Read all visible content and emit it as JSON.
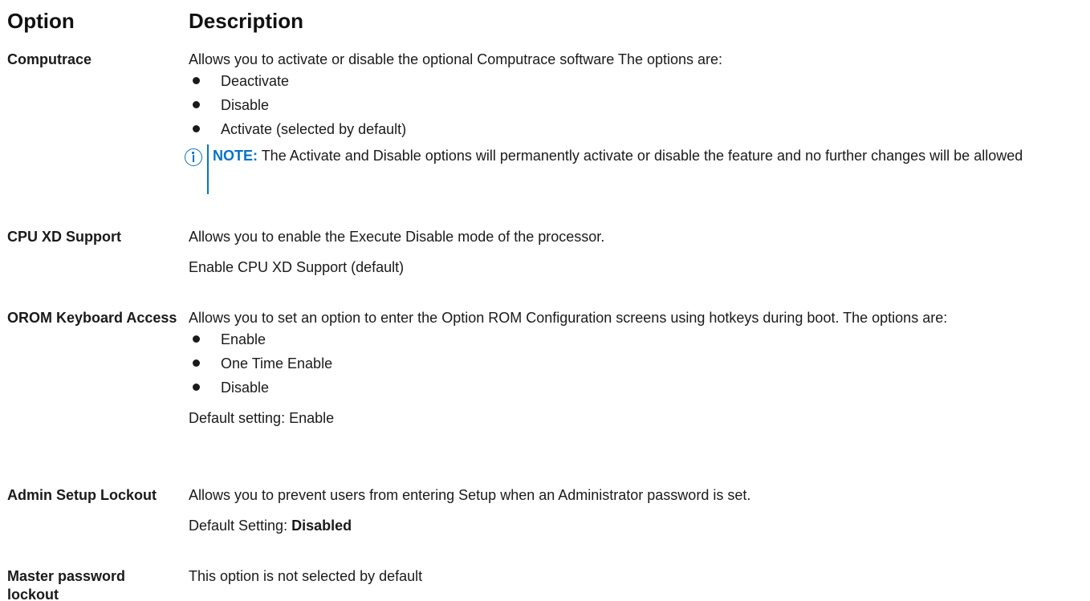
{
  "header": {
    "option": "Option",
    "description": "Description"
  },
  "rows": [
    {
      "option": "Computrace",
      "intro": "Allows you to activate or disable the optional Computrace software The options are:",
      "options": [
        "Deactivate",
        "Disable",
        "Activate (selected by default)"
      ],
      "note": {
        "label": "NOTE:",
        "text": "The Activate and Disable options will permanently activate or disable the feature and no further changes will be allowed"
      }
    },
    {
      "option": "CPU XD Support",
      "intro": "Allows you to enable the Execute Disable mode of the processor.",
      "detail": "Enable CPU XD Support (default)"
    },
    {
      "option": "OROM Keyboard Access",
      "intro": "Allows you to set an option to enter the Option ROM Configuration screens using hotkeys during boot. The options are:",
      "options": [
        "Enable",
        "One Time Enable",
        "Disable"
      ],
      "detail": "Default setting: Enable"
    },
    {
      "option": "Admin Setup Lockout",
      "intro": "Allows you to prevent users from entering Setup when an Administrator password is set.",
      "default_label": "Default Setting:",
      "default_value": "Disabled"
    },
    {
      "option": "Master password lockout",
      "intro": "This option is not selected by default"
    }
  ],
  "icons": {
    "note": "info-circle-icon"
  },
  "colors": {
    "accent": "#0672cb",
    "text": "#1a1a1a"
  }
}
